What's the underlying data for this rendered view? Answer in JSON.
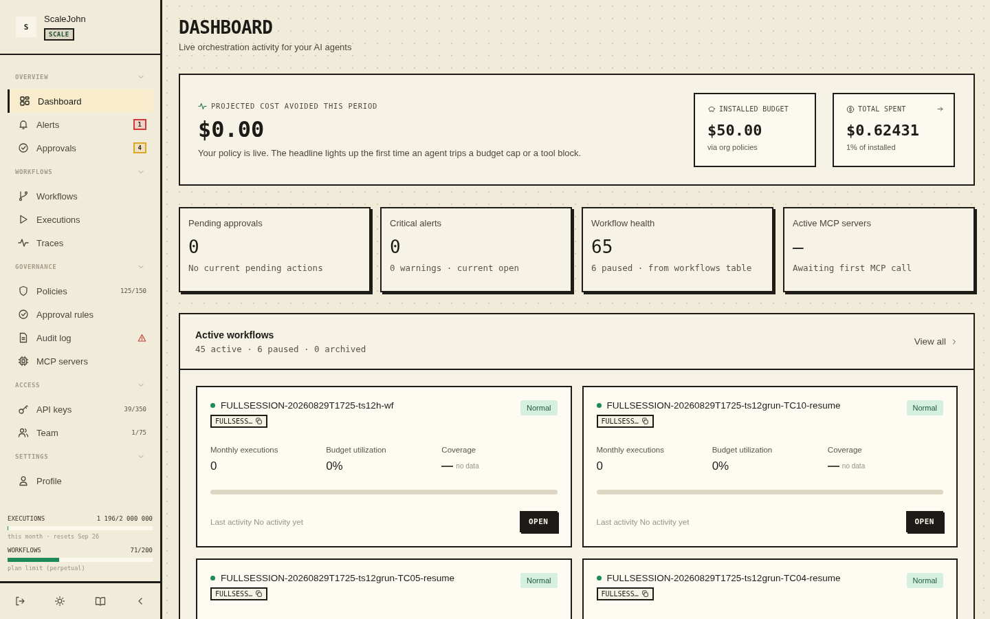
{
  "workspace": {
    "avatar": "S",
    "name": "ScaleJohn",
    "plan": "SCALE"
  },
  "sidebar": {
    "sections": [
      {
        "title": "OVERVIEW",
        "expanded": true,
        "items": [
          {
            "label": "Dashboard",
            "selected": true
          },
          {
            "label": "Alerts",
            "selected": false,
            "badge": "1",
            "color": "#d23a3a"
          },
          {
            "label": "Approvals",
            "selected": false,
            "badge": "4",
            "color": "#e0a526"
          }
        ]
      },
      {
        "title": "WORKFLOWS",
        "expanded": true,
        "items": [
          {
            "label": "Workflows",
            "selected": false
          },
          {
            "label": "Executions",
            "selected": false
          },
          {
            "label": "Traces",
            "selected": false
          }
        ]
      },
      {
        "title": "GOVERNANCE",
        "expanded": true,
        "items": [
          {
            "label": "Policies",
            "selected": false,
            "count": "125/150"
          },
          {
            "label": "Approval rules",
            "selected": false
          },
          {
            "label": "Audit log",
            "selected": false,
            "warning": true
          },
          {
            "label": "MCP servers",
            "selected": false
          }
        ]
      },
      {
        "title": "ACCESS",
        "expanded": true,
        "items": [
          {
            "label": "API keys",
            "selected": false,
            "count": "39/350"
          },
          {
            "label": "Team",
            "selected": false,
            "count": "1/75"
          }
        ]
      },
      {
        "title": "SETTINGS",
        "expanded": true,
        "items": [
          {
            "label": "Profile",
            "selected": false
          }
        ]
      }
    ]
  },
  "usage": [
    {
      "label": "EXECUTIONS",
      "reading": "1 196/2 000 000",
      "level": 0.005,
      "note": "this month · resets Sep 26"
    },
    {
      "label": "WORKFLOWS",
      "reading": "71/200",
      "level": 0.355,
      "note": "plan limit (perpetual)"
    }
  ],
  "header": {
    "title": "DASHBOARD",
    "subtitle": "Live orchestration activity for your AI agents"
  },
  "hero": {
    "label": "PROJECTED COST AVOIDED THIS PERIOD",
    "value": "$0.00",
    "description": "Your policy is live. The headline lights up the first time an agent trips a budget cap or a tool block.",
    "boxes": [
      {
        "label": "INSTALLED BUDGET",
        "value": "$50.00",
        "note": "via org policies",
        "link": false
      },
      {
        "label": "TOTAL SPENT",
        "value": "$0.62431",
        "note": "1% of installed",
        "link": true
      }
    ]
  },
  "stats": [
    {
      "label": "Pending approvals",
      "value": "0",
      "note": "No current pending actions"
    },
    {
      "label": "Critical alerts",
      "value": "0",
      "note": "0 warnings · current open"
    },
    {
      "label": "Workflow health",
      "value": "65",
      "note": "6 paused · from workflows table"
    },
    {
      "label": "Active MCP servers",
      "value": "—",
      "note": "Awaiting first MCP call"
    }
  ],
  "workflows": {
    "title": "Active workflows",
    "summary": "45 active · 6 paused · 0 archived",
    "view_all": "View all",
    "cards": [
      {
        "name": "FULLSESSION-20260829T1725-ts12h-wf",
        "active": true,
        "tag": "FULLSESS…",
        "status": "Normal",
        "metrics": [
          {
            "label": "Monthly executions",
            "value": "0"
          },
          {
            "label": "Budget utilization",
            "value": "0%"
          },
          {
            "label": "Coverage",
            "value": "no data",
            "empty": true
          }
        ],
        "level": 0,
        "activity": "Last activity No activity yet",
        "action": "OPEN"
      },
      {
        "name": "FULLSESSION-20260829T1725-ts12grun-TC10-resume",
        "active": true,
        "tag": "FULLSESS…",
        "status": "Normal",
        "metrics": [
          {
            "label": "Monthly executions",
            "value": "0"
          },
          {
            "label": "Budget utilization",
            "value": "0%"
          },
          {
            "label": "Coverage",
            "value": "no data",
            "empty": true
          }
        ],
        "level": 0,
        "activity": "Last activity No activity yet",
        "action": "OPEN"
      },
      {
        "name": "FULLSESSION-20260829T1725-ts12grun-TC05-resume",
        "active": true,
        "tag": "FULLSESS…",
        "status": "Normal"
      },
      {
        "name": "FULLSESSION-20260829T1725-ts12grun-TC04-resume",
        "active": true,
        "tag": "FULLSESS…",
        "status": "Normal"
      }
    ]
  }
}
